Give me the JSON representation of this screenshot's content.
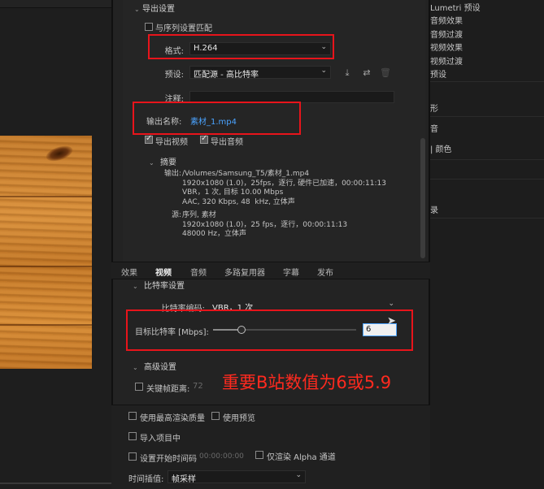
{
  "export_settings": {
    "section_title": "导出设置",
    "match_sequence_label": "与序列设置匹配",
    "format_label": "格式:",
    "format_value": "H.264",
    "preset_label": "预设:",
    "preset_value": "匹配源 - 高比特率",
    "comments_label": "注释:",
    "comments_value": "",
    "output_name_label": "输出名称:",
    "output_name_value": "素材_1.mp4",
    "export_video_label": "导出视频",
    "export_audio_label": "导出音频"
  },
  "summary": {
    "title": "摘要",
    "output_label": "输出:",
    "output_lines": [
      "/Volumes/Samsung_T5/素材_1.mp4",
      "1920x1080 (1.0)，25fps，逐行, 硬件已加速，00:00:11:13",
      "VBR，1 次, 目标 10.00 Mbps",
      "AAC, 320 Kbps, 48  kHz, 立体声"
    ],
    "source_label": "源:",
    "source_lines": [
      "序列, 素材",
      "1920x1080 (1.0)，25 fps，逐行，00:00:11:13",
      "48000 Hz，立体声"
    ]
  },
  "tabs": [
    "效果",
    "视频",
    "音频",
    "多路复用器",
    "字幕",
    "发布"
  ],
  "active_tab": "视频",
  "bitrate": {
    "section_title": "比特率设置",
    "encoding_label": "比特率编码:",
    "encoding_value": "VBR，1 次",
    "target_label": "目标比特率 [Mbps]:",
    "target_value": "6",
    "slider_fraction": 0.2
  },
  "advanced": {
    "section_title": "高级设置",
    "keyframe_label": "关键帧距离:",
    "keyframe_value": "72"
  },
  "annotation_text": "重要B站数值为6或5.9",
  "bottom": {
    "max_render_quality": "使用最高渲染质量",
    "use_previews": "使用预览",
    "import_into_project": "导入项目中",
    "set_start_timecode": "设置开始时间码",
    "start_timecode_value": "00:00:00:00",
    "render_alpha_only": "仅渲染 Alpha 通道",
    "time_interpolation_label": "时间插值:",
    "time_interpolation_value": "帧采样"
  },
  "right_panel": {
    "items": [
      "Lumetri 预设",
      "音频效果",
      "音频过渡",
      "视频效果",
      "视频过渡",
      "预设",
      "形",
      "音",
      "| 颜色",
      "录"
    ]
  },
  "colors": {
    "highlight_box": "#e8141b",
    "link": "#4aa3ff",
    "annotation": "#ff2a1f"
  }
}
